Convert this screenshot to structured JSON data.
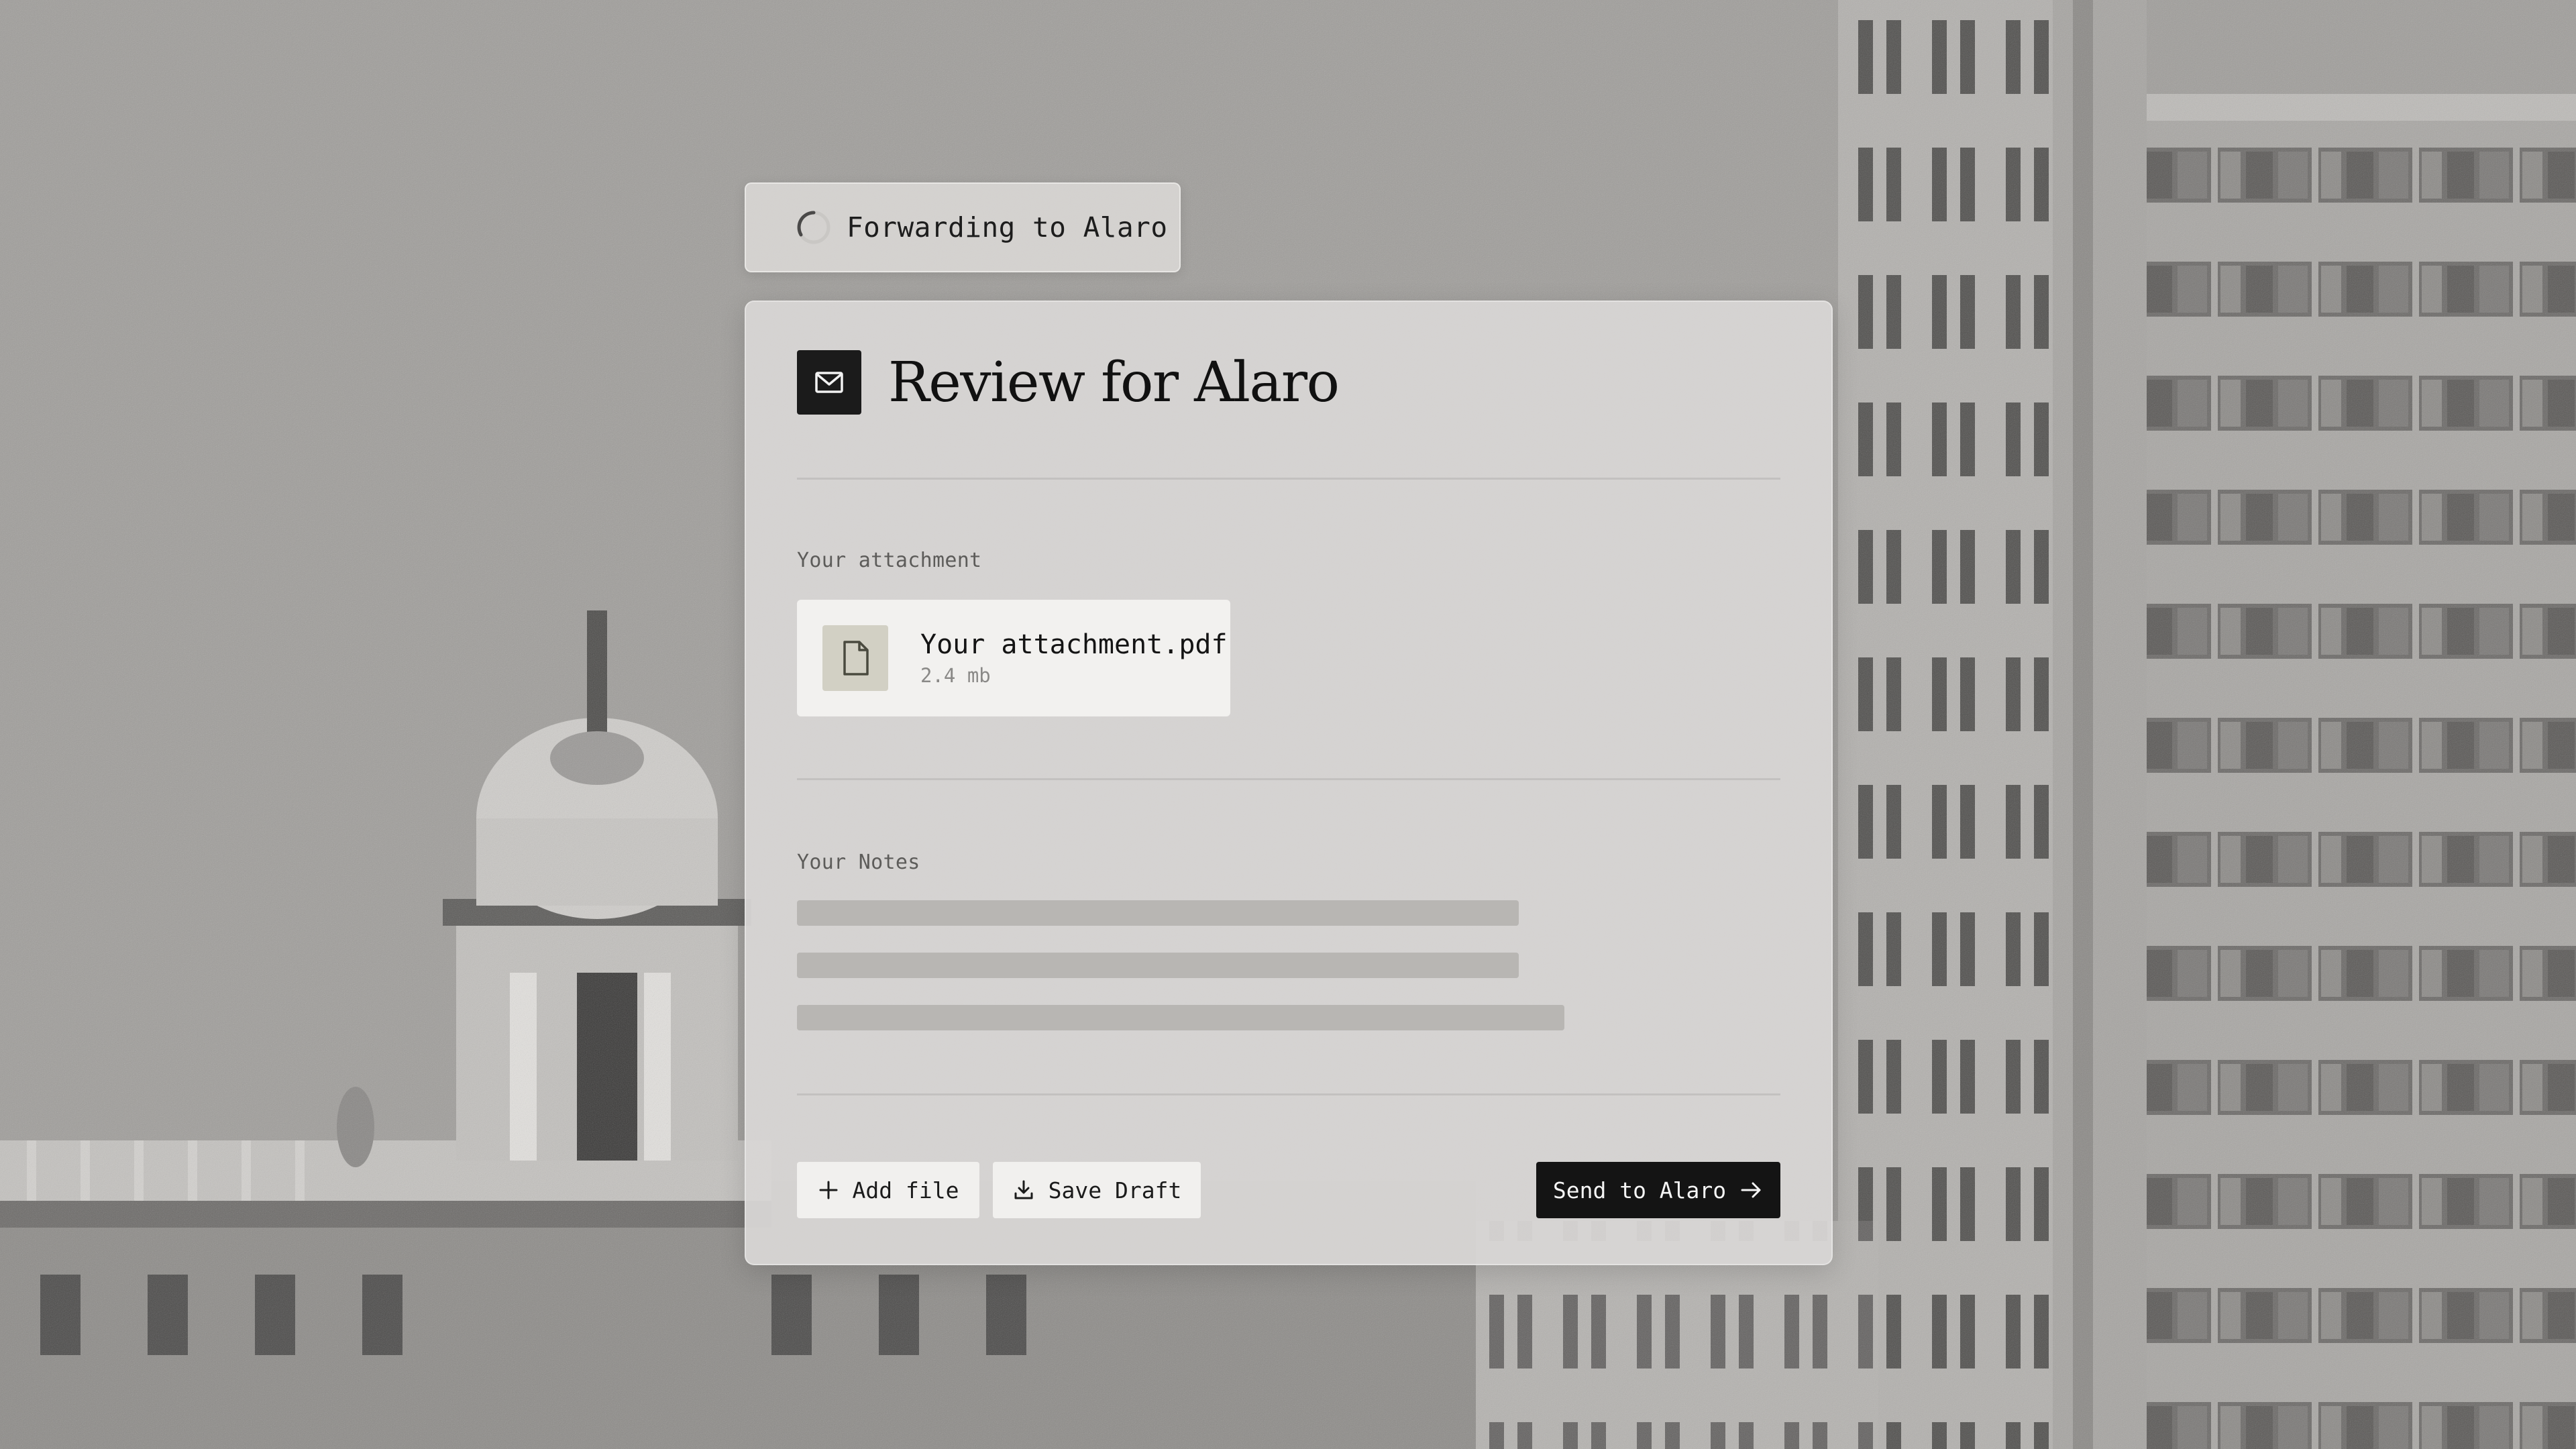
{
  "status": {
    "text": "Forwarding to Alaro"
  },
  "card": {
    "title": "Review for Alaro",
    "attachment_label": "Your attachment",
    "attachment": {
      "name": "Your attachment.pdf",
      "size": "2.4 mb"
    },
    "notes_label": "Your Notes",
    "notes_loading_lines": 3
  },
  "actions": {
    "add_file_label": "Add file",
    "save_draft_label": "Save Draft",
    "send_label": "Send to Alaro"
  },
  "icons": {
    "status": "loading-spinner-icon",
    "header": "mail-icon",
    "file": "document-icon",
    "add": "plus-icon",
    "save": "download-icon",
    "send": "arrow-right-icon"
  },
  "colors": {
    "primary_button": "#141414",
    "card_bg": "#d8d6d4",
    "file_thumb": "#d2d0c4",
    "skeleton": "#b8b6b3"
  }
}
